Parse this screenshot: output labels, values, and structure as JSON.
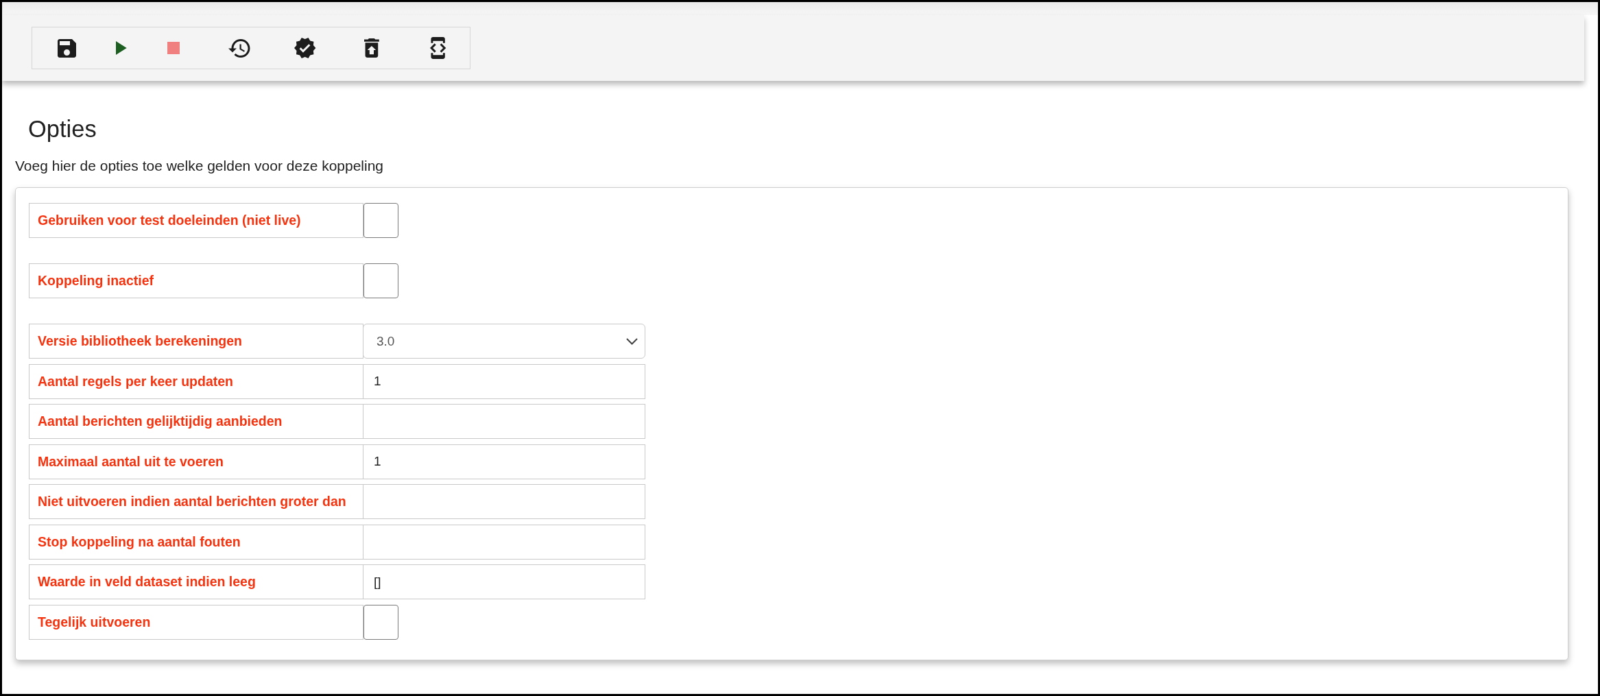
{
  "toolbar": {
    "buttons": [
      {
        "kind": "save"
      },
      {
        "kind": "play"
      },
      {
        "kind": "stop"
      },
      {
        "kind": "history"
      },
      {
        "kind": "verify"
      },
      {
        "kind": "restore"
      },
      {
        "kind": "code"
      }
    ]
  },
  "title": "Opties",
  "description": "Voeg hier de opties toe welke gelden voor deze koppeling",
  "sections": [
    {
      "rows": [
        {
          "kind": "checkbox",
          "label": "Gebruiken voor test doeleinden (niet live)",
          "checked": false
        }
      ]
    },
    {
      "rows": [
        {
          "kind": "checkbox",
          "label": "Koppeling inactief",
          "checked": false
        }
      ]
    },
    {
      "rows": [
        {
          "kind": "select",
          "label": "Versie bibliotheek berekeningen",
          "value": "3.0"
        },
        {
          "kind": "text",
          "label": "Aantal regels per keer updaten",
          "value": "1"
        },
        {
          "kind": "text",
          "label": "Aantal berichten gelijktijdig aanbieden"
        },
        {
          "kind": "text",
          "label": "Maximaal aantal uit te voeren",
          "value": "1"
        },
        {
          "kind": "text",
          "label": "Niet uitvoeren indien aantal berichten groter dan"
        },
        {
          "kind": "text",
          "label": "Stop koppeling na aantal fouten"
        },
        {
          "kind": "text",
          "label": "Waarde in veld dataset indien leeg",
          "value": "[]"
        },
        {
          "kind": "checkbox",
          "label": "Tegelijk uitvoeren",
          "checked": false
        }
      ]
    }
  ]
}
